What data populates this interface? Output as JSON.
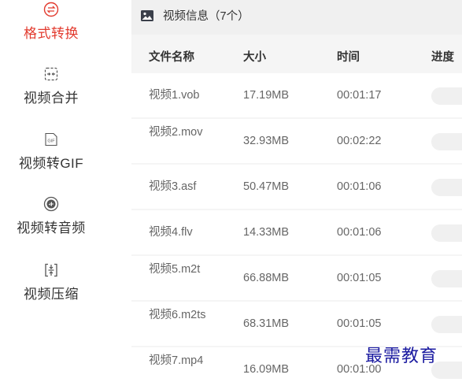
{
  "sidebar": {
    "items": [
      {
        "label": "格式转换",
        "icon": "format-convert-icon",
        "active": true
      },
      {
        "label": "视频合并",
        "icon": "merge-icon",
        "active": false
      },
      {
        "label": "视频转GIF",
        "icon": "gif-icon",
        "active": false
      },
      {
        "label": "视频转音频",
        "icon": "audio-icon",
        "active": false
      },
      {
        "label": "视频压缩",
        "icon": "compress-icon",
        "active": false
      }
    ],
    "gif_icon_text": "GIF"
  },
  "info_bar": {
    "title": "视频信息（7个）"
  },
  "table": {
    "columns": [
      "文件名称",
      "大小",
      "时间",
      "进度"
    ],
    "rows": [
      {
        "name": "视频1.vob",
        "size": "17.19MB",
        "time": "00:01:17"
      },
      {
        "name": "视频2.mov",
        "size": "32.93MB",
        "time": "00:02:22"
      },
      {
        "name": "视频3.asf",
        "size": "50.47MB",
        "time": "00:01:06"
      },
      {
        "name": "视频4.flv",
        "size": "14.33MB",
        "time": "00:01:06"
      },
      {
        "name": "视频5.m2t",
        "size": "66.88MB",
        "time": "00:01:05"
      },
      {
        "name": "视频6.m2ts",
        "size": "68.31MB",
        "time": "00:01:05"
      },
      {
        "name": "视频7.mp4",
        "size": "16.09MB",
        "time": "00:01:00"
      }
    ]
  },
  "watermark": "最需教育",
  "colors": {
    "accent": "#e23a2e",
    "watermark": "#1a1aa0"
  }
}
